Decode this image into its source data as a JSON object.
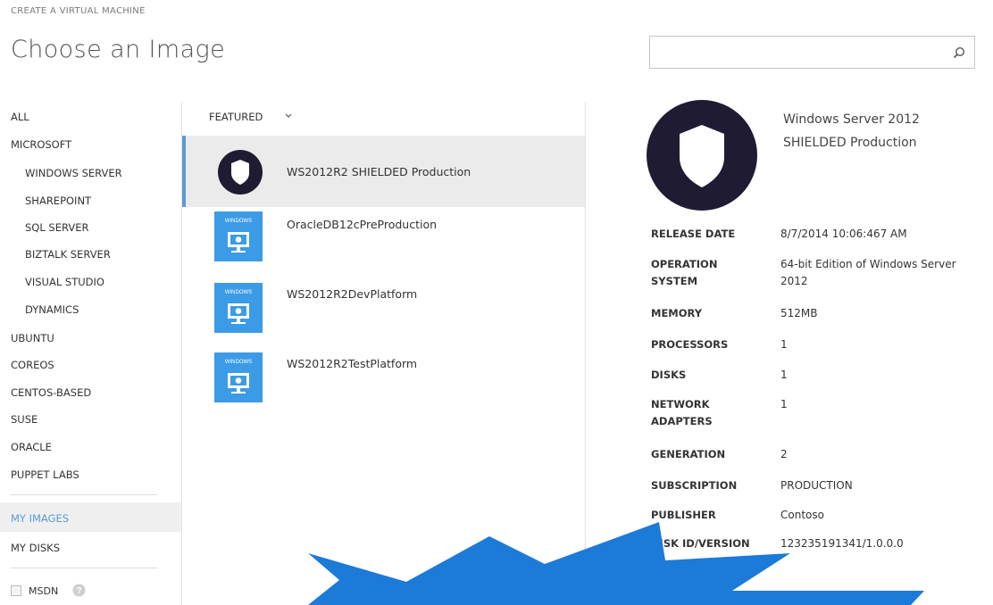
{
  "header": {
    "wizard_label": "CREATE A VIRTUAL MACHINE",
    "title": "Choose an Image",
    "search_placeholder": ""
  },
  "nav": {
    "items": [
      {
        "label": "ALL",
        "level": 0
      },
      {
        "label": "MICROSOFT",
        "level": 0
      },
      {
        "label": "WINDOWS SERVER",
        "level": 1
      },
      {
        "label": "SHAREPOINT",
        "level": 1
      },
      {
        "label": "SQL SERVER",
        "level": 1
      },
      {
        "label": "BIZTALK SERVER",
        "level": 1
      },
      {
        "label": "VISUAL STUDIO",
        "level": 1
      },
      {
        "label": "DYNAMICS",
        "level": 1
      },
      {
        "label": "UBUNTU",
        "level": 0
      },
      {
        "label": "COREOS",
        "level": 0
      },
      {
        "label": "CENTOS-BASED",
        "level": 0
      },
      {
        "label": "SUSE",
        "level": 0
      },
      {
        "label": "ORACLE",
        "level": 0
      },
      {
        "label": "PUPPET LABS",
        "level": 0
      }
    ],
    "my_images": "MY IMAGES",
    "my_disks": "MY DISKS",
    "msdn_label": "MSDN",
    "msdn_checked": false
  },
  "list": {
    "filter_label": "FEATURED",
    "items": [
      {
        "name": "WS2012R2 SHIELDED Production",
        "icon": "shield-icon",
        "selected": true
      },
      {
        "name": "OracleDB12cPreProduction",
        "icon": "windows-monitor-icon",
        "selected": false
      },
      {
        "name": "WS2012R2DevPlatform",
        "icon": "windows-monitor-icon",
        "selected": false
      },
      {
        "name": "WS2012R2TestPlatform",
        "icon": "windows-monitor-icon",
        "selected": false
      }
    ],
    "tile_text": "WINDOWS"
  },
  "details": {
    "title_line1": "Windows Server 2012",
    "title_line2": "SHIELDED Production",
    "rows": [
      {
        "label": "RELEASE DATE",
        "value": "8/7/2014 10:06:467 AM"
      },
      {
        "label": "OPERATION SYSTEM",
        "value": "64-bit Edition of Windows Server 2012"
      },
      {
        "label": "MEMORY",
        "value": "512MB"
      },
      {
        "label": "PROCESSORS",
        "value": "1"
      },
      {
        "label": "DISKS",
        "value": "1"
      },
      {
        "label": "NETWORK ADAPTERS",
        "value": "1"
      },
      {
        "label": "GENERATION",
        "value": "2"
      },
      {
        "label": "SUBSCRIPTION",
        "value": "PRODUCTION"
      },
      {
        "label": "PUBLISHER",
        "value": "Contoso"
      },
      {
        "label": "DISK ID/VERSION",
        "value": "123235191341/1.0.0.0"
      }
    ]
  },
  "colors": {
    "accent": "#5b9bd5",
    "selected_bg": "#ebebeb",
    "tile_blue": "#3c9be6",
    "shield_dark": "#1e1b33",
    "burst_blue": "#1c7ad8"
  }
}
